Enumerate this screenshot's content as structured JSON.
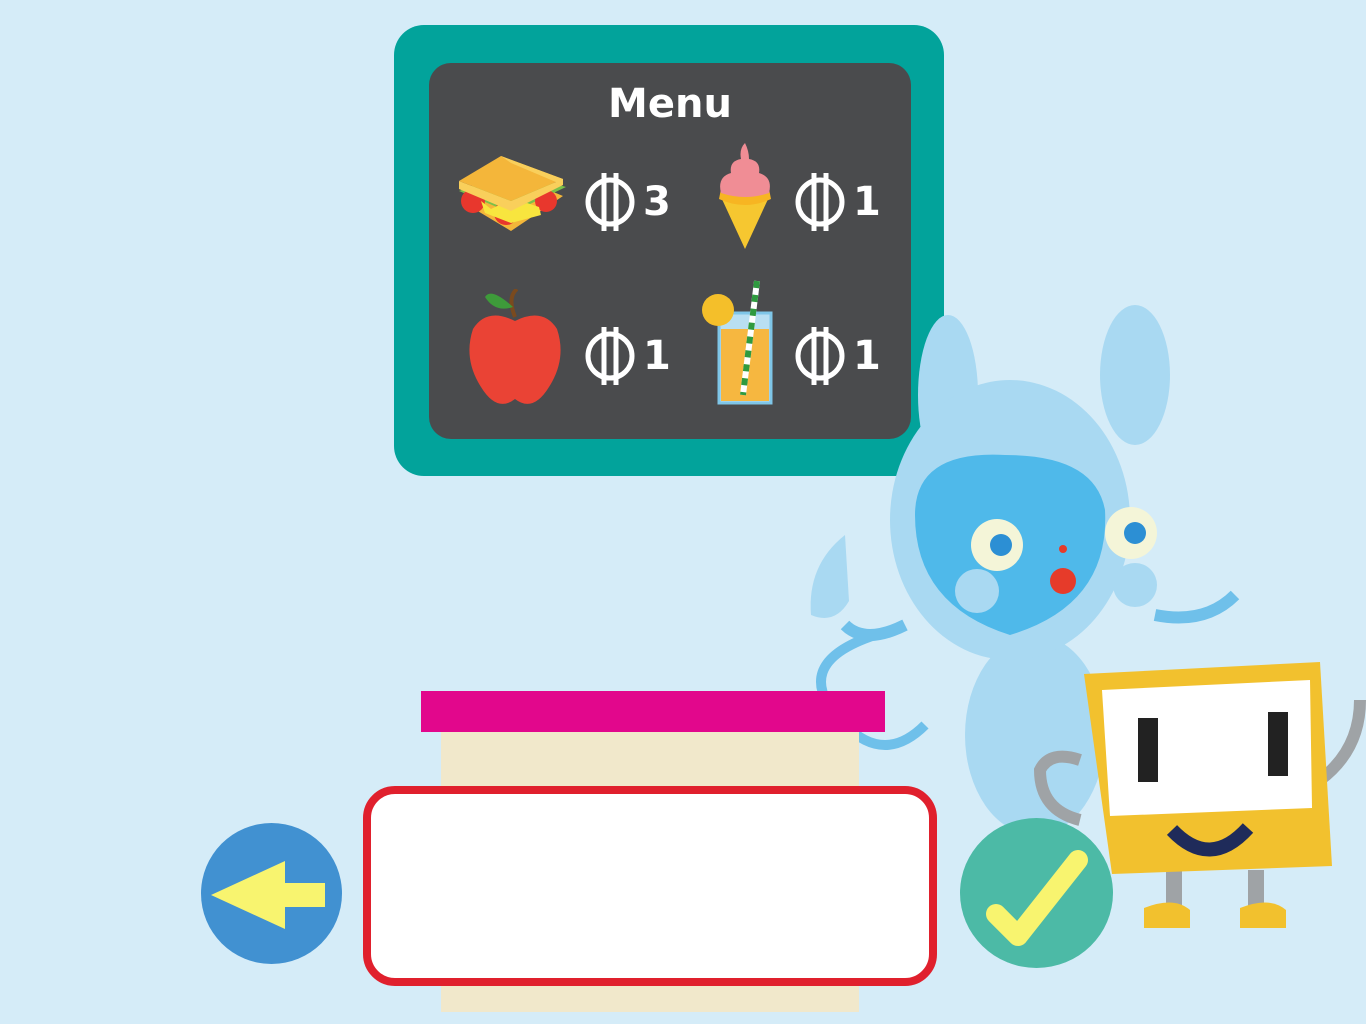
{
  "menu": {
    "title": "Menu",
    "items": [
      {
        "name": "sandwich",
        "price": "3",
        "icon": "sandwich-icon"
      },
      {
        "name": "ice cream",
        "price": "1",
        "icon": "ice-cream-icon"
      },
      {
        "name": "apple",
        "price": "1",
        "icon": "apple-icon"
      },
      {
        "name": "juice",
        "price": "1",
        "icon": "juice-icon"
      }
    ],
    "currency_icon": "coin-currency-icon"
  },
  "answer": {
    "value": ""
  },
  "controls": {
    "back_icon": "arrow-left-icon",
    "check_icon": "checkmark-icon"
  },
  "colors": {
    "background": "#d5ecf8",
    "board_frame": "#02a39b",
    "board": "#4a4b4d",
    "answer_border": "#e0202d",
    "pink_bar": "#e2078c",
    "back_button": "#4191d1",
    "check_button": "#4cbaa6",
    "arrow": "#f8f46f"
  }
}
